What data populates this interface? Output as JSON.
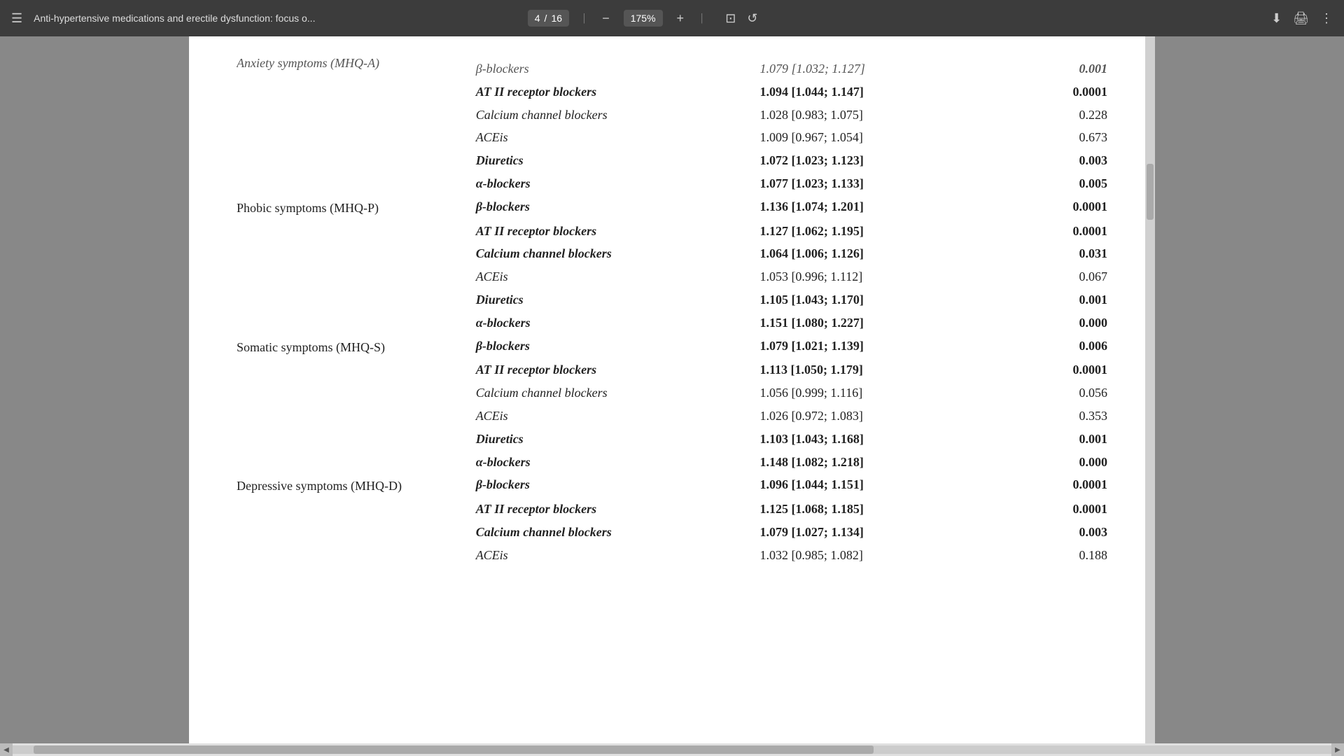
{
  "toolbar": {
    "menu_label": "☰",
    "title": "Anti-hypertensive medications and erectile dysfunction: focus o...",
    "page_current": "4",
    "page_total": "16",
    "zoom": "175%",
    "download_icon": "⬇",
    "print_icon": "🖨",
    "more_icon": "⋮",
    "fit_icon": "⊡",
    "rotate_icon": "↺",
    "minus_icon": "−",
    "plus_icon": "+"
  },
  "content": {
    "partial_top": {
      "category": "Anxiety symptoms (MHQ-A)",
      "medication": "β-blockers",
      "value": "1.079 [1.032; 1.127]",
      "pvalue": "0.001"
    },
    "rows": [
      {
        "category": "",
        "medication": "AT II receptor blockers",
        "value": "1.094 [1.044; 1.147]",
        "pvalue": "0.0001",
        "bold": true
      },
      {
        "category": "",
        "medication": "Calcium channel blockers",
        "value": "1.028 [0.983; 1.075]",
        "pvalue": "0.228",
        "bold": false
      },
      {
        "category": "",
        "medication": "ACEis",
        "value": "1.009 [0.967; 1.054]",
        "pvalue": "0.673",
        "bold": false
      },
      {
        "category": "",
        "medication": "Diuretics",
        "value": "1.072 [1.023; 1.123]",
        "pvalue": "0.003",
        "bold": true
      },
      {
        "category": "",
        "medication": "α-blockers",
        "value": "1.077 [1.023; 1.133]",
        "pvalue": "0.005",
        "bold": true
      },
      {
        "category": "Phobic symptoms (MHQ-P)",
        "medication": "β-blockers",
        "value": "1.136 [1.074; 1.201]",
        "pvalue": "0.0001",
        "bold": true
      },
      {
        "category": "",
        "medication": "AT II receptor blockers",
        "value": "1.127 [1.062; 1.195]",
        "pvalue": "0.0001",
        "bold": true
      },
      {
        "category": "",
        "medication": "Calcium channel blockers",
        "value": "1.064 [1.006; 1.126]",
        "pvalue": "0.031",
        "bold": true
      },
      {
        "category": "",
        "medication": "ACEis",
        "value": "1.053 [0.996; 1.112]",
        "pvalue": "0.067",
        "bold": false
      },
      {
        "category": "",
        "medication": "Diuretics",
        "value": "1.105 [1.043; 1.170]",
        "pvalue": "0.001",
        "bold": true
      },
      {
        "category": "",
        "medication": "α-blockers",
        "value": "1.151 [1.080; 1.227]",
        "pvalue": "0.000",
        "bold": true
      },
      {
        "category": "Somatic symptoms (MHQ-S)",
        "medication": "β-blockers",
        "value": "1.079 [1.021; 1.139]",
        "pvalue": "0.006",
        "bold": true
      },
      {
        "category": "",
        "medication": "AT II receptor blockers",
        "value": "1.113 [1.050; 1.179]",
        "pvalue": "0.0001",
        "bold": true
      },
      {
        "category": "",
        "medication": "Calcium channel blockers",
        "value": "1.056 [0.999; 1.116]",
        "pvalue": "0.056",
        "bold": false
      },
      {
        "category": "",
        "medication": "ACEis",
        "value": "1.026 [0.972; 1.083]",
        "pvalue": "0.353",
        "bold": false
      },
      {
        "category": "",
        "medication": "Diuretics",
        "value": "1.103 [1.043; 1.168]",
        "pvalue": "0.001",
        "bold": true
      },
      {
        "category": "",
        "medication": "α-blockers",
        "value": "1.148 [1.082; 1.218]",
        "pvalue": "0.000",
        "bold": true
      },
      {
        "category": "Depressive symptoms (MHQ-D)",
        "medication": "β-blockers",
        "value": "1.096 [1.044; 1.151]",
        "pvalue": "0.0001",
        "bold": true
      },
      {
        "category": "",
        "medication": "AT II receptor blockers",
        "value": "1.125 [1.068; 1.185]",
        "pvalue": "0.0001",
        "bold": true
      },
      {
        "category": "",
        "medication": "Calcium channel blockers",
        "value": "1.079 [1.027; 1.134]",
        "pvalue": "0.003",
        "bold": true
      },
      {
        "category": "",
        "medication": "ACEis",
        "value": "1.032 [0.985; 1.082]",
        "pvalue": "0.188",
        "bold": false
      }
    ]
  }
}
